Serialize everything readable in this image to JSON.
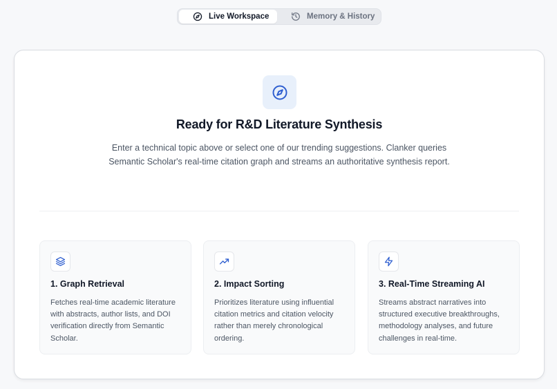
{
  "tabs": [
    {
      "label": "Live Workspace",
      "icon": "compass-icon",
      "active": true
    },
    {
      "label": "Memory & History",
      "icon": "history-icon",
      "active": false
    }
  ],
  "hero": {
    "icon": "compass-icon",
    "title": "Ready for R&D Literature Synthesis",
    "description": "Enter a technical topic above or select one of our trending suggestions. Clanker queries Semantic Scholar's real-time citation graph and streams an authoritative synthesis report."
  },
  "features": [
    {
      "icon": "layers-icon",
      "title": "1. Graph Retrieval",
      "text": "Fetches real-time academic literature with abstracts, author lists, and DOI verification directly from Semantic Scholar."
    },
    {
      "icon": "trending-up-icon",
      "title": "2. Impact Sorting",
      "text": "Prioritizes literature using influential citation metrics and citation velocity rather than merely chronological ordering."
    },
    {
      "icon": "lightning-icon",
      "title": "3. Real-Time Streaming AI",
      "text": "Streams abstract narratives into structured executive breakthroughs, methodology analyses, and future challenges in real-time."
    }
  ],
  "colors": {
    "accent": "#2f5fd0",
    "hero_icon_bg": "#e8f0fb"
  }
}
